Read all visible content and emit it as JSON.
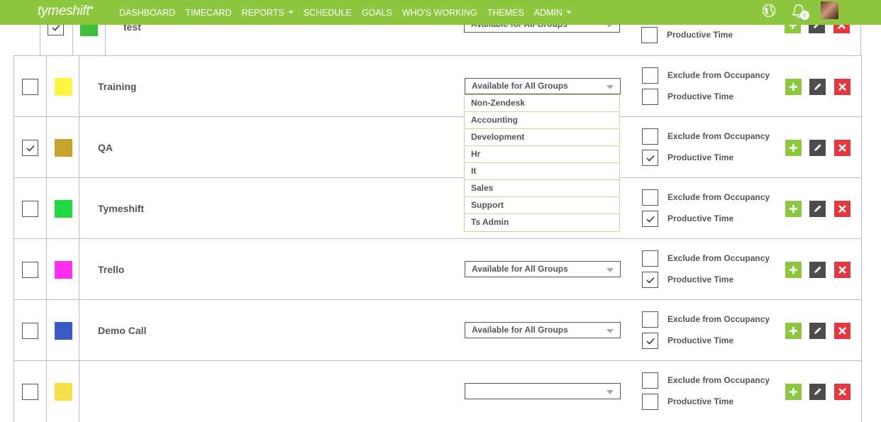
{
  "nav": {
    "logo": "tymeshift",
    "items": [
      {
        "label": "DASHBOARD",
        "dropdown": false
      },
      {
        "label": "TIMECARD",
        "dropdown": false
      },
      {
        "label": "REPORTS",
        "dropdown": true
      },
      {
        "label": "SCHEDULE",
        "dropdown": false
      },
      {
        "label": "GOALS",
        "dropdown": false
      },
      {
        "label": "WHO'S WORKING",
        "dropdown": false
      },
      {
        "label": "THEMES",
        "dropdown": false
      },
      {
        "label": "ADMIN",
        "dropdown": true
      }
    ],
    "notification_count": "6"
  },
  "colors": {
    "brand": "#8dc63f",
    "edit": "#4d4d4d",
    "delete": "#e5373f",
    "border": "#bdbdbd"
  },
  "labels": {
    "exclude": "Exclude from Occupancy",
    "productive": "Productive Time"
  },
  "rows": [
    {
      "name": "test",
      "checked": true,
      "color": "#3fbf3a",
      "select": "Available for All Groups",
      "exclude": false,
      "productive": false
    },
    {
      "name": "Training",
      "checked": false,
      "color": "#fff441",
      "select": "Available for All Groups",
      "exclude": false,
      "productive": false
    },
    {
      "name": "QA",
      "checked": true,
      "color": "#c4a32e",
      "select": "",
      "exclude": false,
      "productive": true
    },
    {
      "name": "Tymeshift",
      "checked": false,
      "color": "#22d845",
      "select": "",
      "exclude": false,
      "productive": true
    },
    {
      "name": "Trello",
      "checked": false,
      "color": "#ff2ef0",
      "select": "Available for All Groups",
      "exclude": false,
      "productive": true
    },
    {
      "name": "Demo Call",
      "checked": false,
      "color": "#3c5ac4",
      "select": "Available for All Groups",
      "exclude": false,
      "productive": true
    },
    {
      "name": "",
      "checked": false,
      "color": "#f5e04a",
      "select": "",
      "exclude": false,
      "productive": false
    }
  ],
  "dropdown": {
    "options": [
      "Non-Zendesk",
      "Accounting",
      "Development",
      "Hr",
      "It",
      "Sales",
      "Support",
      "Ts Admin"
    ]
  }
}
